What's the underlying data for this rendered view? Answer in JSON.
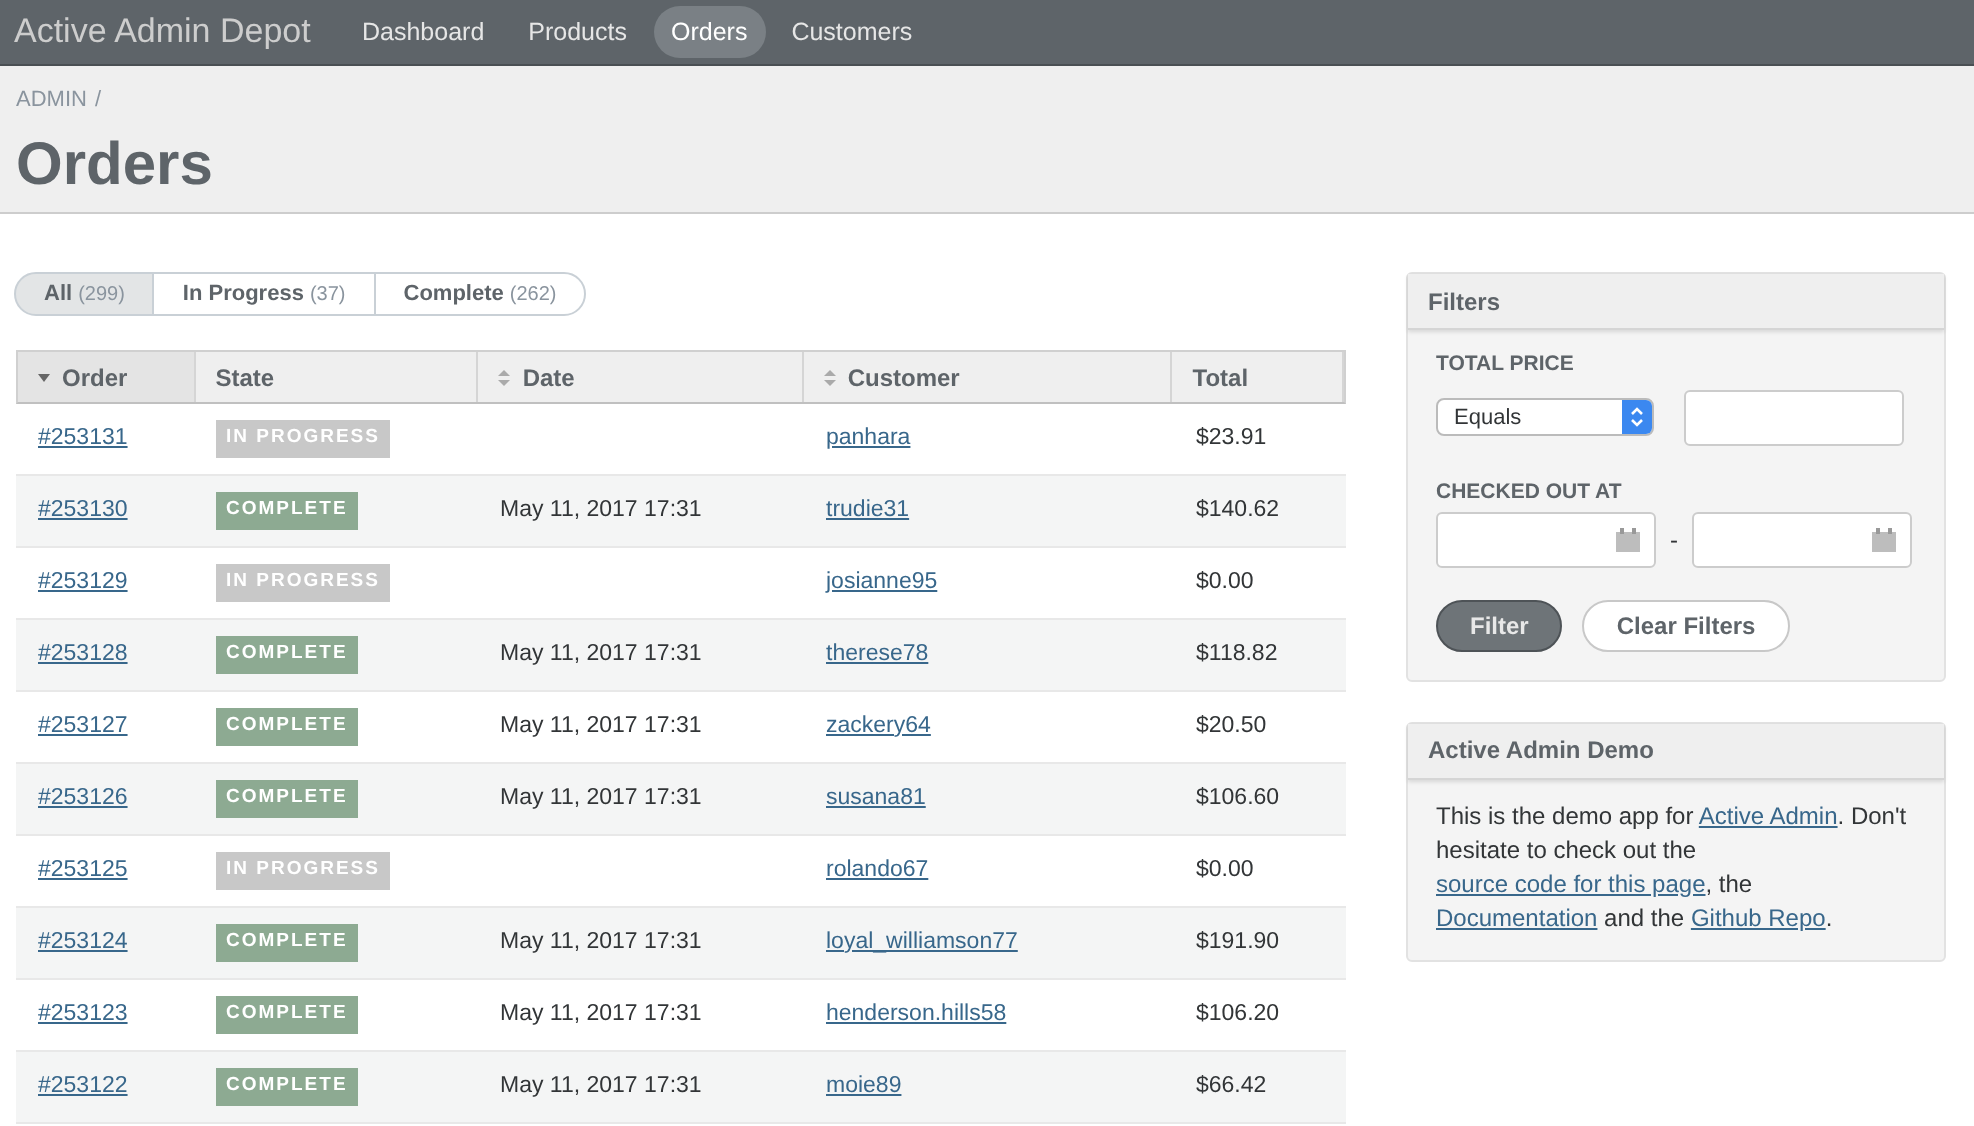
{
  "header": {
    "site_title": "Active Admin Depot",
    "nav": [
      {
        "label": "Dashboard",
        "selected": false
      },
      {
        "label": "Products",
        "selected": false
      },
      {
        "label": "Orders",
        "selected": true
      },
      {
        "label": "Customers",
        "selected": false
      }
    ]
  },
  "breadcrumb": [
    "ADMIN",
    "/"
  ],
  "page_title": "Orders",
  "scopes": [
    {
      "label": "All",
      "count": "(299)",
      "selected": true
    },
    {
      "label": "In Progress",
      "count": "(37)",
      "selected": false
    },
    {
      "label": "Complete",
      "count": "(262)",
      "selected": false
    }
  ],
  "table": {
    "columns": [
      {
        "label": "Order",
        "kind": "sorted"
      },
      {
        "label": "State",
        "kind": "plain"
      },
      {
        "label": "Date",
        "kind": "sortable"
      },
      {
        "label": "Customer",
        "kind": "sortable"
      },
      {
        "label": "Total",
        "kind": "plain"
      }
    ],
    "rows": [
      {
        "order": "#253131",
        "state": {
          "text": "IN PROGRESS",
          "kind": "in_progress"
        },
        "customer": "panhara",
        "total": "$23.91"
      },
      {
        "order": "#253130",
        "state": {
          "text": "COMPLETE",
          "kind": "complete"
        },
        "date": "May 11, 2017 17:31",
        "customer": "trudie31",
        "total": "$140.62"
      },
      {
        "order": "#253129",
        "state": {
          "text": "IN PROGRESS",
          "kind": "in_progress"
        },
        "customer": "josianne95",
        "total": "$0.00"
      },
      {
        "order": "#253128",
        "state": {
          "text": "COMPLETE",
          "kind": "complete"
        },
        "date": "May 11, 2017 17:31",
        "customer": "therese78",
        "total": "$118.82"
      },
      {
        "order": "#253127",
        "state": {
          "text": "COMPLETE",
          "kind": "complete"
        },
        "date": "May 11, 2017 17:31",
        "customer": "zackery64",
        "total": "$20.50"
      },
      {
        "order": "#253126",
        "state": {
          "text": "COMPLETE",
          "kind": "complete"
        },
        "date": "May 11, 2017 17:31",
        "customer": "susana81",
        "total": "$106.60"
      },
      {
        "order": "#253125",
        "state": {
          "text": "IN PROGRESS",
          "kind": "in_progress"
        },
        "customer": "rolando67",
        "total": "$0.00"
      },
      {
        "order": "#253124",
        "state": {
          "text": "COMPLETE",
          "kind": "complete"
        },
        "date": "May 11, 2017 17:31",
        "customer": "loyal_williamson77",
        "total": "$191.90"
      },
      {
        "order": "#253123",
        "state": {
          "text": "COMPLETE",
          "kind": "complete"
        },
        "date": "May 11, 2017 17:31",
        "customer": "henderson.hills58",
        "total": "$106.20"
      },
      {
        "order": "#253122",
        "state": {
          "text": "COMPLETE",
          "kind": "complete"
        },
        "date": "May 11, 2017 17:31",
        "customer": "moie89",
        "total": "$66.42"
      }
    ]
  },
  "filters": {
    "title": "Filters",
    "total_price": {
      "label": "TOTAL PRICE",
      "operator": "Equals"
    },
    "checked_out_at": {
      "label": "CHECKED OUT AT",
      "separator": "-"
    },
    "buttons": [
      "Filter",
      "Clear Filters"
    ]
  },
  "demo": {
    "title": "Active Admin Demo",
    "paragraph": [
      {
        "kind": "text",
        "text": "This is the demo app for "
      },
      {
        "kind": "link",
        "text": "Active Admin"
      },
      {
        "kind": "text",
        "text": ". Don't hesitate to check out the "
      },
      {
        "kind": "link",
        "text": "source code for this page"
      },
      {
        "kind": "text",
        "text": ", the "
      },
      {
        "kind": "link",
        "text": "Documentation"
      },
      {
        "kind": "text",
        "text": " and the "
      },
      {
        "kind": "link",
        "text": "Github Repo"
      },
      {
        "kind": "text",
        "text": "."
      }
    ]
  }
}
